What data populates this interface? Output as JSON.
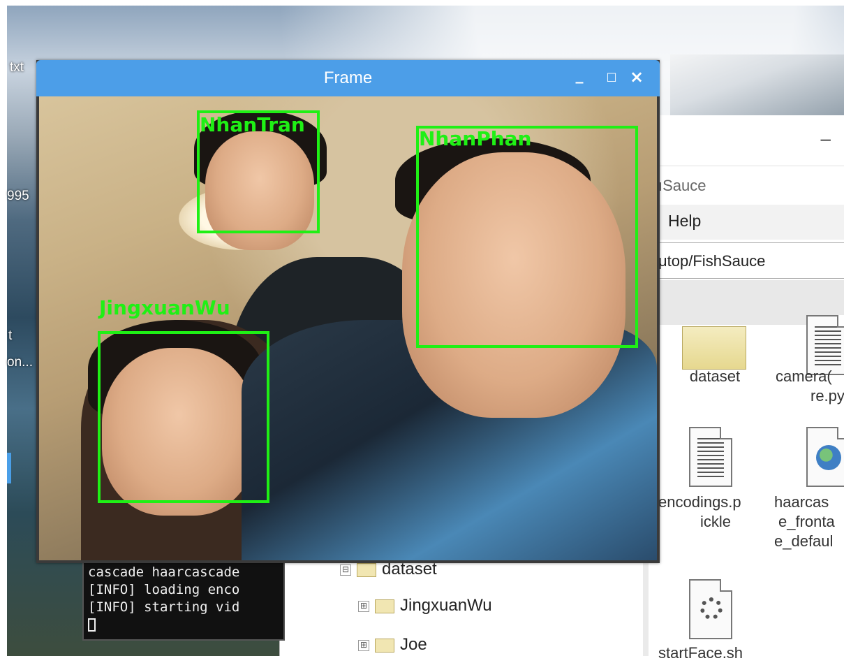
{
  "desktop": {
    "labels": [
      "txt",
      "995",
      "t",
      "on..."
    ]
  },
  "frame_window": {
    "title": "Frame",
    "minimize_glyph": "_",
    "maximize_glyph": "□",
    "close_glyph": "×",
    "detections": [
      {
        "name": "NhanTran"
      },
      {
        "name": "NhanPhan"
      },
      {
        "name": "JingxuanWu"
      }
    ]
  },
  "terminal": {
    "lines": [
      "cascade haarcascade",
      "[INFO] loading enco",
      "[INFO] starting vid"
    ]
  },
  "file_manager": {
    "minimize_glyph": "–",
    "title_partial": "ıSauce",
    "menu_help": "Help",
    "address": "μtop/FishSauce",
    "icons": [
      {
        "label_lines": [
          "dataset"
        ],
        "icon": "folder-icon"
      },
      {
        "label_lines": [
          "camera(",
          "re.py"
        ],
        "icon": "text-file-icon"
      },
      {
        "label_lines": [
          "encodings.p",
          "ickle"
        ],
        "icon": "text-file-icon"
      },
      {
        "label_lines": [
          "haarcas",
          "e_fronta",
          "e_defaul"
        ],
        "icon": "globe-file-icon"
      },
      {
        "label_lines": [
          "startFace.sh"
        ],
        "icon": "gear-file-icon"
      }
    ],
    "tree": [
      {
        "expander": "⊟",
        "label": "dataset"
      },
      {
        "expander": "⊞",
        "label": "JingxuanWu"
      },
      {
        "expander": "⊞",
        "label": "Joe"
      }
    ]
  }
}
